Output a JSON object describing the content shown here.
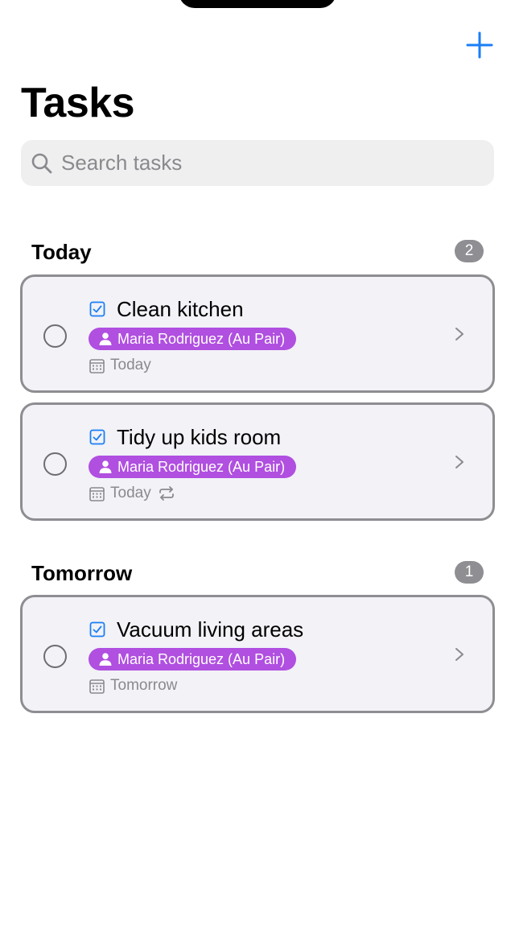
{
  "header": {
    "title": "Tasks",
    "add_icon": "plus-icon"
  },
  "search": {
    "placeholder": "Search tasks",
    "value": ""
  },
  "colors": {
    "accent": "#1a7ef5",
    "assignee_pill": "#b04fe0",
    "card_border": "#8e8e92",
    "card_background": "#f2f2f7",
    "badge": "#8e8e93"
  },
  "sections": [
    {
      "title": "Today",
      "count": "2",
      "tasks": [
        {
          "title": "Clean kitchen",
          "assignee": "Maria Rodriguez (Au Pair)",
          "due": "Today",
          "repeats": false
        },
        {
          "title": "Tidy up kids room",
          "assignee": "Maria Rodriguez (Au Pair)",
          "due": "Today",
          "repeats": true
        }
      ]
    },
    {
      "title": "Tomorrow",
      "count": "1",
      "tasks": [
        {
          "title": "Vacuum living areas",
          "assignee": "Maria Rodriguez (Au Pair)",
          "due": "Tomorrow",
          "repeats": false
        }
      ]
    }
  ]
}
